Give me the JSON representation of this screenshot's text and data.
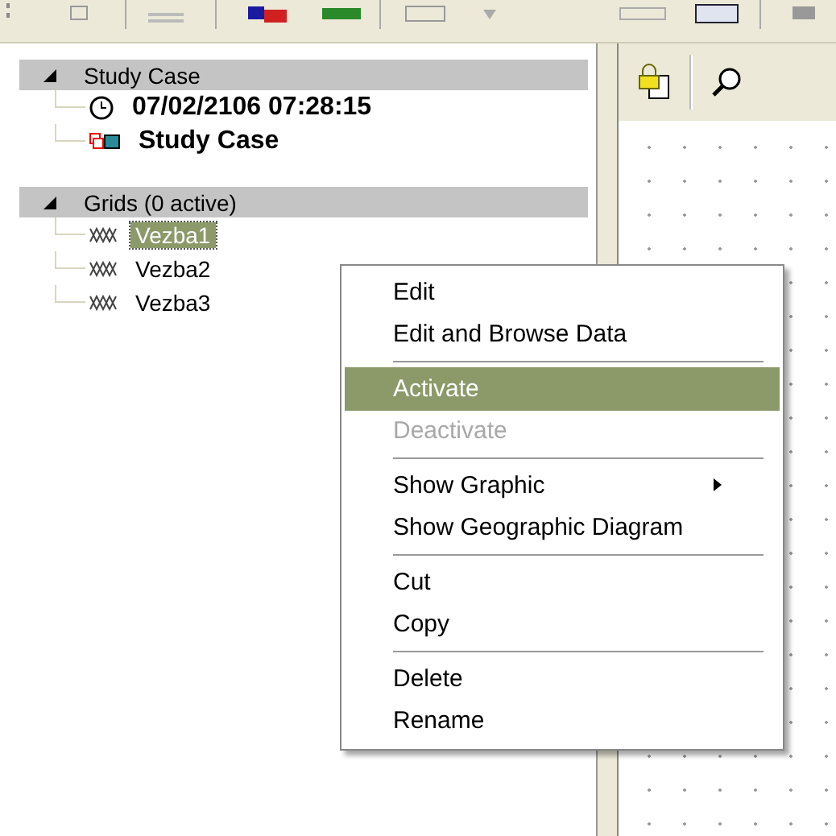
{
  "tree": {
    "sections": [
      {
        "title": "Study Case",
        "expanded": true,
        "items": [
          {
            "kind": "time",
            "label": "07/02/2106 07:28:15",
            "selected": false
          },
          {
            "kind": "case",
            "label": "Study Case",
            "selected": false
          }
        ]
      },
      {
        "title": "Grids (0 active)",
        "expanded": true,
        "items": [
          {
            "kind": "grid",
            "label": "Vezba1",
            "selected": true
          },
          {
            "kind": "grid",
            "label": "Vezba2",
            "selected": false
          },
          {
            "kind": "grid",
            "label": "Vezba3",
            "selected": false
          }
        ]
      }
    ]
  },
  "context_menu": {
    "items": [
      {
        "kind": "item",
        "label": "Edit",
        "selected": false,
        "disabled": false,
        "submenu": false
      },
      {
        "kind": "item",
        "label": "Edit and Browse Data",
        "selected": false,
        "disabled": false,
        "submenu": false
      },
      {
        "kind": "separator"
      },
      {
        "kind": "item",
        "label": "Activate",
        "selected": true,
        "disabled": false,
        "submenu": false
      },
      {
        "kind": "item",
        "label": "Deactivate",
        "selected": false,
        "disabled": true,
        "submenu": false
      },
      {
        "kind": "separator"
      },
      {
        "kind": "item",
        "label": "Show Graphic",
        "selected": false,
        "disabled": false,
        "submenu": true
      },
      {
        "kind": "item",
        "label": "Show Geographic Diagram",
        "selected": false,
        "disabled": false,
        "submenu": false
      },
      {
        "kind": "separator"
      },
      {
        "kind": "item",
        "label": "Cut",
        "selected": false,
        "disabled": false,
        "submenu": false
      },
      {
        "kind": "item",
        "label": "Copy",
        "selected": false,
        "disabled": false,
        "submenu": false
      },
      {
        "kind": "separator"
      },
      {
        "kind": "item",
        "label": "Delete",
        "selected": false,
        "disabled": false,
        "submenu": false
      },
      {
        "kind": "item",
        "label": "Rename",
        "selected": false,
        "disabled": false,
        "submenu": false
      }
    ]
  }
}
